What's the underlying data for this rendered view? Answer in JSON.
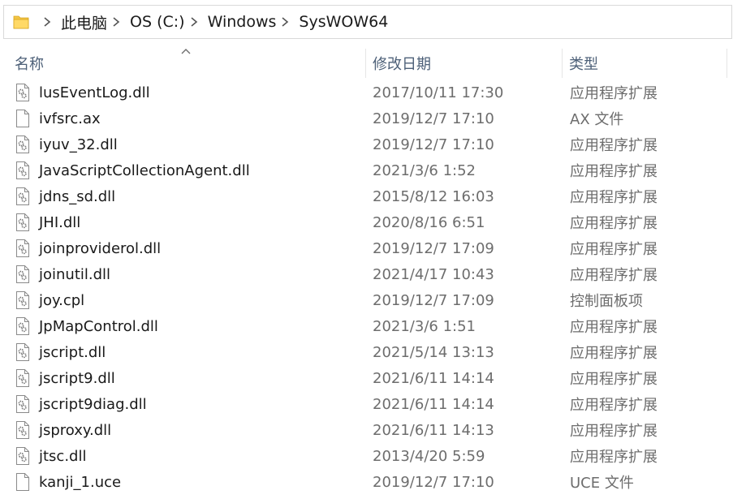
{
  "address_bar": {
    "breadcrumbs": [
      "此电脑",
      "OS (C:)",
      "Windows",
      "SysWOW64"
    ]
  },
  "columns": {
    "name": "名称",
    "date_modified": "修改日期",
    "type": "类型"
  },
  "files": [
    {
      "name": "lusEventLog.dll",
      "date": "2017/10/11 17:30",
      "type": "应用程序扩展",
      "icon": "dll-icon"
    },
    {
      "name": "ivfsrc.ax",
      "date": "2019/12/7 17:10",
      "type": "AX 文件",
      "icon": "blank-file-icon"
    },
    {
      "name": "iyuv_32.dll",
      "date": "2019/12/7 17:10",
      "type": "应用程序扩展",
      "icon": "dll-icon"
    },
    {
      "name": "JavaScriptCollectionAgent.dll",
      "date": "2021/3/6 1:52",
      "type": "应用程序扩展",
      "icon": "dll-icon"
    },
    {
      "name": "jdns_sd.dll",
      "date": "2015/8/12 16:03",
      "type": "应用程序扩展",
      "icon": "dll-icon"
    },
    {
      "name": "JHI.dll",
      "date": "2020/8/16 6:51",
      "type": "应用程序扩展",
      "icon": "dll-icon"
    },
    {
      "name": "joinproviderol.dll",
      "date": "2019/12/7 17:09",
      "type": "应用程序扩展",
      "icon": "dll-icon"
    },
    {
      "name": "joinutil.dll",
      "date": "2021/4/17 10:43",
      "type": "应用程序扩展",
      "icon": "dll-icon"
    },
    {
      "name": "joy.cpl",
      "date": "2019/12/7 17:09",
      "type": "控制面板项",
      "icon": "dll-icon"
    },
    {
      "name": "JpMapControl.dll",
      "date": "2021/3/6 1:51",
      "type": "应用程序扩展",
      "icon": "dll-icon"
    },
    {
      "name": "jscript.dll",
      "date": "2021/5/14 13:13",
      "type": "应用程序扩展",
      "icon": "dll-icon"
    },
    {
      "name": "jscript9.dll",
      "date": "2021/6/11 14:14",
      "type": "应用程序扩展",
      "icon": "dll-icon"
    },
    {
      "name": "jscript9diag.dll",
      "date": "2021/6/11 14:14",
      "type": "应用程序扩展",
      "icon": "dll-icon"
    },
    {
      "name": "jsproxy.dll",
      "date": "2021/6/11 14:13",
      "type": "应用程序扩展",
      "icon": "dll-icon"
    },
    {
      "name": "jtsc.dll",
      "date": "2013/4/20 5:59",
      "type": "应用程序扩展",
      "icon": "dll-icon"
    },
    {
      "name": "kanji_1.uce",
      "date": "2019/12/7 17:10",
      "type": "UCE 文件",
      "icon": "blank-file-icon"
    }
  ],
  "colors": {
    "header_text": "#4d6078",
    "secondary_text": "#6d6d6d",
    "folder_yellow": "#f3c544"
  }
}
